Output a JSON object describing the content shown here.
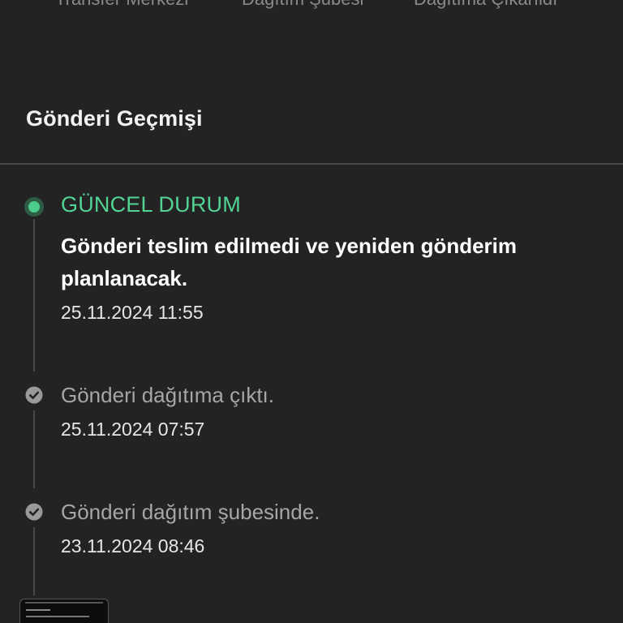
{
  "tracking_steps": [
    {
      "label": "Transfer Merkezi"
    },
    {
      "label": "Dağıtım Şubesi"
    },
    {
      "label": "Dağıtıma Çıkarıldı"
    }
  ],
  "history": {
    "title": "Gönderi Geçmişi",
    "current": {
      "status_label": "GÜNCEL DURUM",
      "text": "Gönderi teslim edilmedi ve yeniden gönderim planlanacak.",
      "timestamp": "25.11.2024 11:55"
    },
    "events": [
      {
        "text": "Gönderi dağıtıma çıktı.",
        "timestamp": "25.11.2024 07:57"
      },
      {
        "text": "Gönderi dağıtım şubesinde.",
        "timestamp": "23.11.2024 08:46"
      }
    ]
  },
  "colors": {
    "background": "#232323",
    "accent_green": "#52d394",
    "muted_text": "#a6a6a6",
    "divider": "#4a4a4a"
  },
  "icons": {
    "current": "current-status-dot-icon",
    "past": "check-circle-icon"
  }
}
